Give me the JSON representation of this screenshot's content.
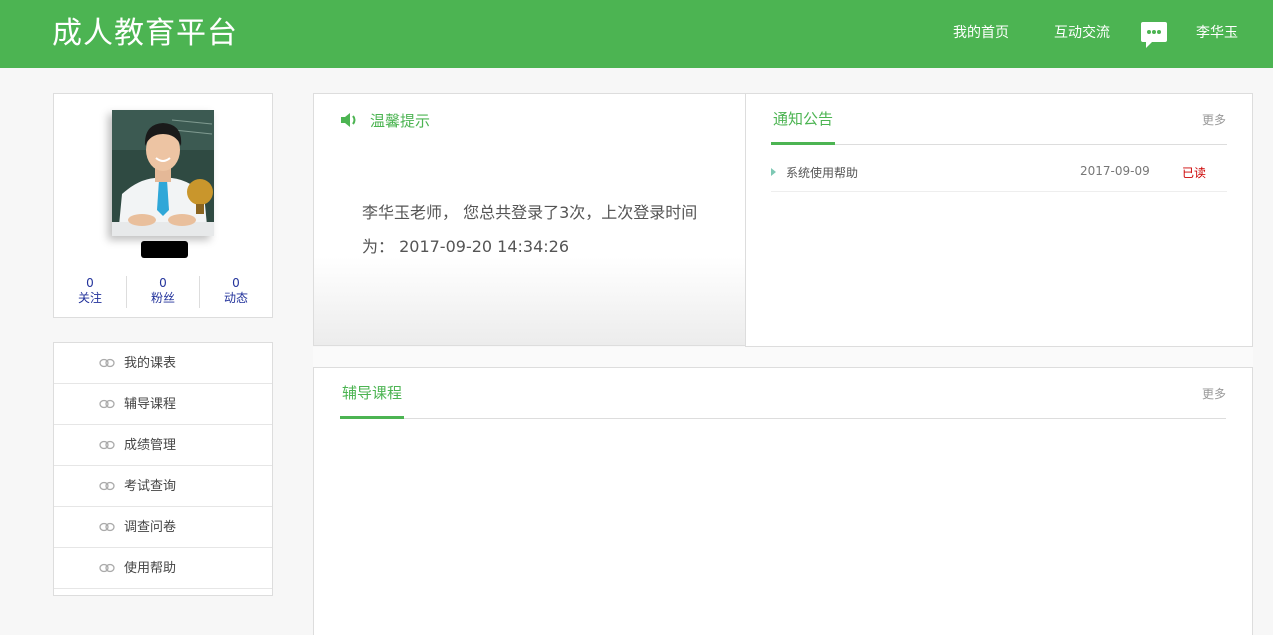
{
  "header": {
    "brand": "成人教育平台",
    "nav": {
      "home": "我的首页",
      "chat": "互动交流",
      "user": "李华玉"
    },
    "accent_color": "#4cb452",
    "message_icon": "chat-bubble-icon"
  },
  "profile": {
    "stats": [
      {
        "count": "0",
        "label": "关注"
      },
      {
        "count": "0",
        "label": "粉丝"
      },
      {
        "count": "0",
        "label": "动态"
      }
    ]
  },
  "menu": {
    "items": [
      {
        "label": "我的课表"
      },
      {
        "label": "辅导课程"
      },
      {
        "label": "成绩管理"
      },
      {
        "label": "考试查询"
      },
      {
        "label": "调查问卷"
      },
      {
        "label": "使用帮助"
      }
    ],
    "item_icon": "link-chain-icon"
  },
  "tips": {
    "title": "温馨提示",
    "text": "李华玉老师， 您总共登录了3次，上次登录时间为： 2017-09-20 14:34:26"
  },
  "notice": {
    "tab": "通知公告",
    "more": "更多",
    "rows": [
      {
        "title": "系统使用帮助",
        "date": "2017-09-09",
        "status": "已读"
      }
    ]
  },
  "course": {
    "tab": "辅导课程",
    "more": "更多"
  }
}
